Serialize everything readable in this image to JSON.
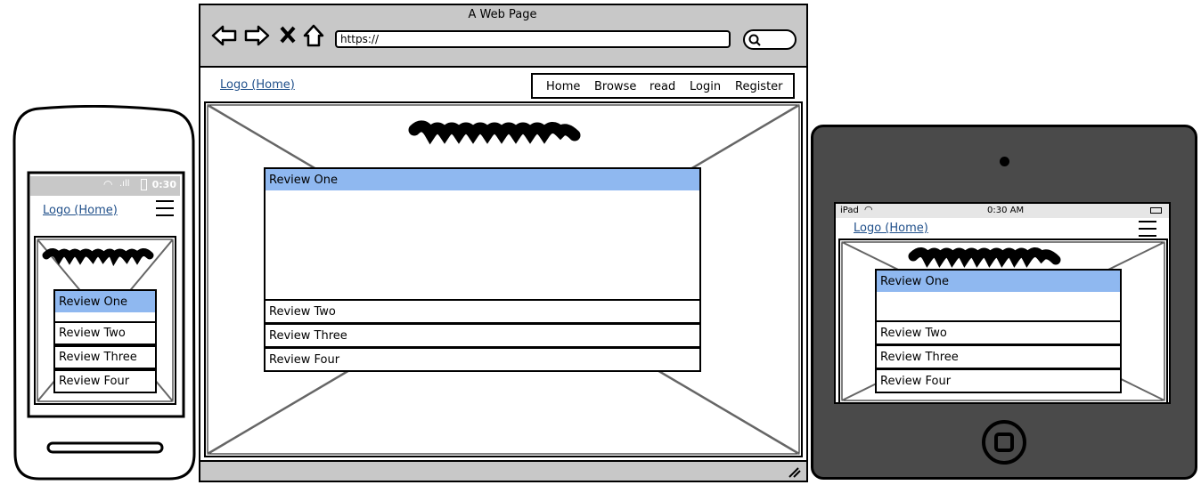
{
  "browser": {
    "title": "A Web Page",
    "url": "https://",
    "logo": "Logo (Home)",
    "nav": [
      "Home",
      "Browse",
      "read",
      "Login",
      "Register"
    ],
    "reviews": [
      "Review One",
      "Review Two",
      "Review Three",
      "Review Four"
    ]
  },
  "phone": {
    "status_time": "0:30",
    "logo": "Logo (Home)",
    "reviews": [
      "Review One",
      "Review Two",
      "Review Three",
      "Review Four"
    ]
  },
  "tablet": {
    "device_label": "iPad",
    "status_time": "0:30 AM",
    "logo": "Logo (Home)",
    "reviews": [
      "Review One",
      "Review Two",
      "Review Three",
      "Review Four"
    ]
  },
  "colors": {
    "selected": "#8fb8f0",
    "chrome": "#c8c8c8",
    "tablet_body": "#4a4a4a",
    "link": "#1f4f8a"
  }
}
